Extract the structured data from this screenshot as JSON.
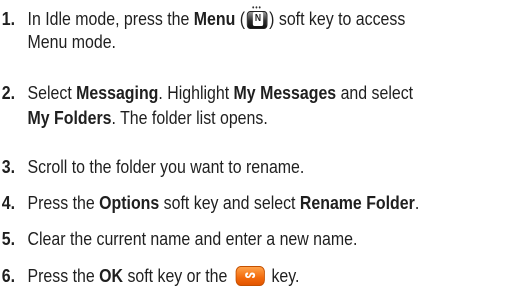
{
  "steps": [
    {
      "number": "1.",
      "lines": [
        {
          "t1": "In Idle mode, press the ",
          "b1": "Menu",
          "t2": " (",
          "icon": "menu-soft-key-icon",
          "icon_letter": "N",
          "t3": ") soft key to access"
        },
        {
          "t1": "Menu mode."
        }
      ]
    },
    {
      "number": "2.",
      "lines": [
        {
          "t1": "Select ",
          "b1": "Messaging",
          "t2": ". Highlight ",
          "b2": "My Messages",
          "t3": " and select"
        },
        {
          "b1": "My Folders",
          "t1": ". The folder list opens."
        }
      ]
    },
    {
      "number": "3.",
      "lines": [
        {
          "t1": "Scroll to the folder you want to rename."
        }
      ]
    },
    {
      "number": "4.",
      "lines": [
        {
          "t1": "Press the ",
          "b1": "Options",
          "t2": " soft key and select ",
          "b2": "Rename Folder",
          "t3": "."
        }
      ]
    },
    {
      "number": "5.",
      "lines": [
        {
          "t1": "Clear the current name and enter a new name."
        }
      ]
    },
    {
      "number": "6.",
      "lines": [
        {
          "t1": "Press the ",
          "b1": "OK",
          "t2": " soft key or the ",
          "icon": "ok-key-icon",
          "t3": " key."
        }
      ]
    }
  ],
  "colors": {
    "text": "#1f1f1f",
    "ok_key_orange": "#f26a0c",
    "menu_key_dark": "#2d2d2d"
  }
}
